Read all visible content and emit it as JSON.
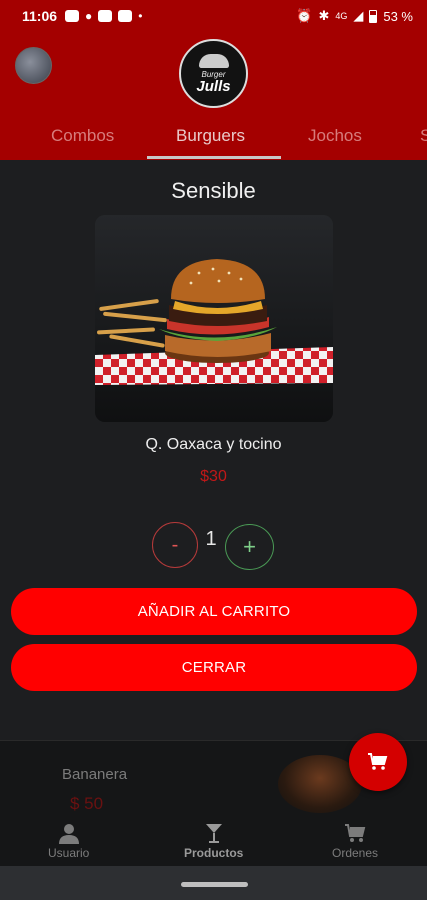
{
  "status_bar": {
    "time": "11:06",
    "network": "4G",
    "battery": "53 %"
  },
  "header": {
    "logo_top": "Burger",
    "logo_bottom": "Julls"
  },
  "tabs": [
    {
      "label": "Combos",
      "active": false
    },
    {
      "label": "Burguers",
      "active": true
    },
    {
      "label": "Jochos",
      "active": false
    },
    {
      "label": "S",
      "active": false
    }
  ],
  "modal": {
    "title": "Sensible",
    "description": "Q. Oaxaca y tocino",
    "price": "$30",
    "quantity": "1",
    "minus_label": "-",
    "plus_label": "+",
    "add_button": "AÑADIR AL CARRITO",
    "close_button": "CERRAR"
  },
  "background_item": {
    "name": "Bananera",
    "price": "$ 50"
  },
  "bottom_nav": [
    {
      "label": "Usuario",
      "icon": "user-icon"
    },
    {
      "label": "Productos",
      "icon": "glass-icon",
      "active": true
    },
    {
      "label": "Ordenes",
      "icon": "cart-icon"
    }
  ],
  "colors": {
    "header": "#a40000",
    "accent": "#ff0000",
    "background": "#1d1e20"
  }
}
